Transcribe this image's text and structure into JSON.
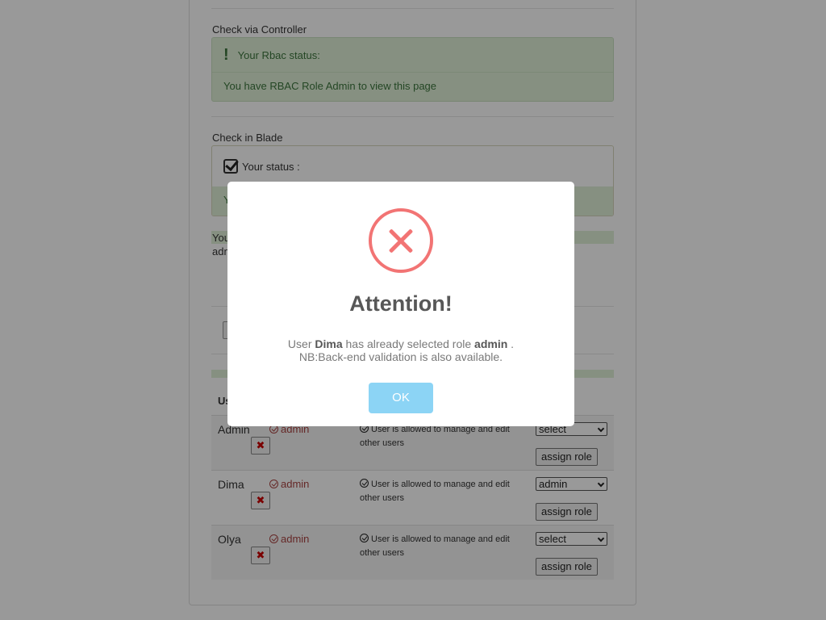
{
  "sections": {
    "controller_title": "Check via Controller",
    "rbac_status_label": "Your Rbac status:",
    "rbac_status_text": "You have RBAC Role Admin to view this page",
    "blade_title": "Check in Blade",
    "blade_status_label": "Your status :",
    "blade_status_text": "Y",
    "partial_you": "You",
    "partial_adm": "adm"
  },
  "users_table": {
    "header_partial": "Us",
    "rows": [
      {
        "name": "Admin",
        "role": "admin",
        "permission": "User is allowed to manage and edit other users",
        "select_value": "select",
        "assign_label": "assign role"
      },
      {
        "name": "Dima",
        "role": "admin",
        "permission": "User is allowed to manage and edit other users",
        "select_value": "admin",
        "assign_label": "assign role"
      },
      {
        "name": "Olya",
        "role": "admin",
        "permission": "User is allowed to manage and edit other users",
        "select_value": "select",
        "assign_label": "assign role"
      }
    ],
    "delete_symbol": "✖"
  },
  "modal": {
    "title": "Attention!",
    "line1_prefix": "User ",
    "user_name": "Dima",
    "line1_middle": " has already selected role ",
    "role_name": "admin",
    "line1_suffix": " .",
    "line2": "NB:Back-end validation is also available.",
    "ok_label": "OK",
    "icon": "error-x-icon"
  },
  "colors": {
    "success_bg": "#dff0d8",
    "success_text": "#3c763d",
    "danger_text": "#a94442",
    "error_icon": "#f27474",
    "ok_button": "#8cd4f5"
  }
}
